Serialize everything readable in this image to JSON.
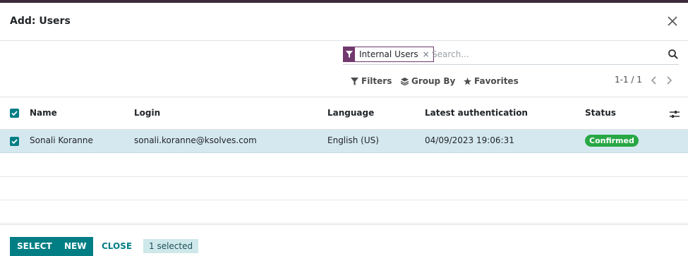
{
  "dialog": {
    "title": "Add: Users"
  },
  "search": {
    "facet_label": "Internal Users",
    "facet_remove": "×",
    "placeholder": "Search..."
  },
  "toolbar": {
    "filters_label": "Filters",
    "group_by_label": "Group By",
    "favorites_label": "Favorites",
    "pager": "1-1 / 1"
  },
  "table": {
    "headers": {
      "name": "Name",
      "login": "Login",
      "language": "Language",
      "latest_auth": "Latest authentication",
      "status": "Status"
    },
    "rows": [
      {
        "name": "Sonali Koranne",
        "login": "sonali.koranne@ksolves.com",
        "language": "English (US)",
        "latest_auth": "04/09/2023 19:06:31",
        "status": "Confirmed"
      }
    ]
  },
  "footer": {
    "select_label": "SELECT",
    "new_label": "NEW",
    "close_label": "CLOSE",
    "selected_count": "1 selected"
  },
  "colors": {
    "accent": "#017e84",
    "facet": "#71396d",
    "status_confirmed": "#28a745",
    "selected_row": "#d5e8ef"
  },
  "icons": [
    "close-icon",
    "filter-icon",
    "search-icon",
    "layers-icon",
    "star-icon",
    "chevron-left-icon",
    "chevron-right-icon",
    "checkbox-icon",
    "column-settings-icon"
  ]
}
